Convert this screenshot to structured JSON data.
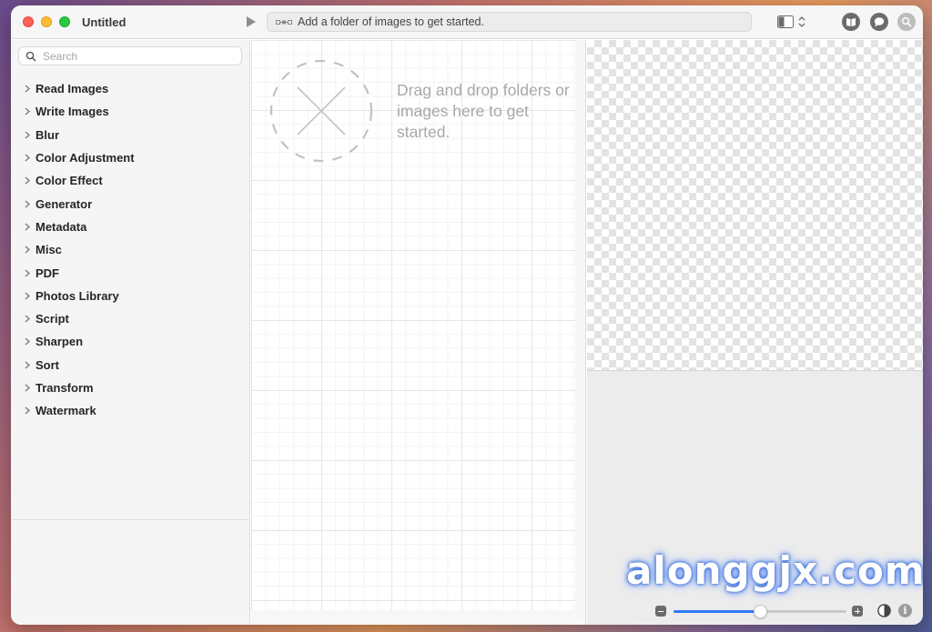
{
  "window": {
    "title": "Untitled"
  },
  "toolbar": {
    "run_icon": "play-icon",
    "address_text": "Add a folder of images to get started.",
    "address_icon": "workflow-icon",
    "layout_icon": "sidebar-layout-icon",
    "buttons": [
      "book-icon",
      "chat-icon",
      "search-icon"
    ]
  },
  "sidebar": {
    "search_placeholder": "Search",
    "items": [
      {
        "label": "Read Images"
      },
      {
        "label": "Write Images"
      },
      {
        "label": "Blur"
      },
      {
        "label": "Color Adjustment"
      },
      {
        "label": "Color Effect"
      },
      {
        "label": "Generator"
      },
      {
        "label": "Metadata"
      },
      {
        "label": "Misc"
      },
      {
        "label": "PDF"
      },
      {
        "label": "Photos Library"
      },
      {
        "label": "Script"
      },
      {
        "label": "Sharpen"
      },
      {
        "label": "Sort"
      },
      {
        "label": "Transform"
      },
      {
        "label": "Watermark"
      }
    ]
  },
  "canvas": {
    "drop_message": "Drag and drop folders or images here to get started."
  },
  "preview": {
    "zoom_level": 0.5
  },
  "watermark_text": "alonggjx.com",
  "colors": {
    "accent": "#2f7cf6",
    "close": "#fe5f57",
    "minimize": "#febc2e",
    "maximize": "#28c840"
  }
}
